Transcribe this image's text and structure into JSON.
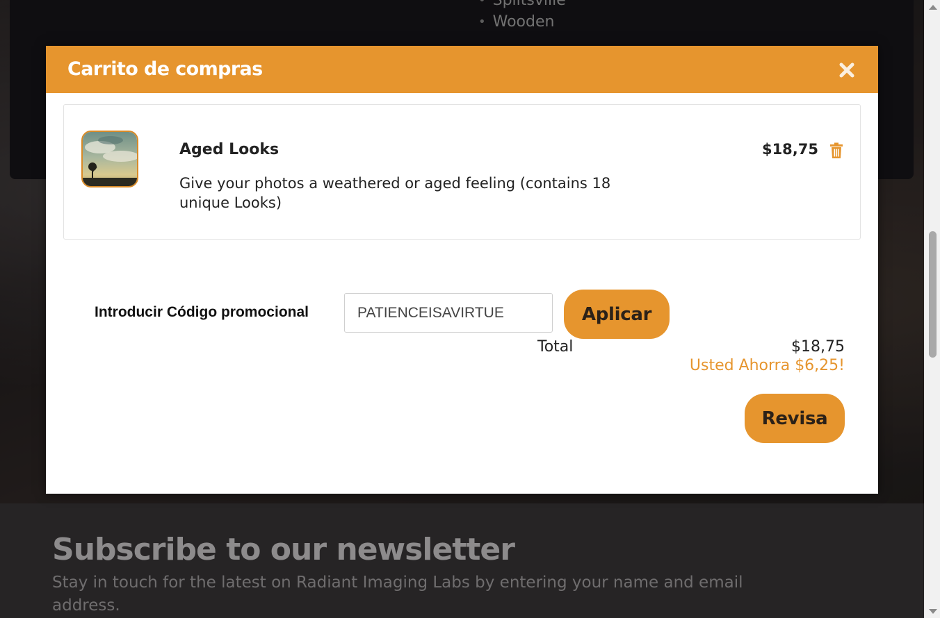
{
  "background": {
    "list_items": [
      "Splitsville",
      "Wooden"
    ],
    "newsletter": {
      "title": "Subscribe to our newsletter",
      "text": "Stay in touch for the latest on Radiant Imaging Labs by entering your name and email address."
    }
  },
  "cart": {
    "title": "Carrito de compras",
    "close_icon": "close-icon",
    "item": {
      "name": "Aged Looks",
      "description": "Give your photos a weathered or aged feeling (contains 18 unique Looks)",
      "price": "$18,75",
      "thumbnail": "aged-looks-thumbnail",
      "delete_icon": "trash-icon"
    },
    "promo": {
      "label": "Introducir Código promocional",
      "value": "PATIENCEISAVIRTUE",
      "apply_label": "Aplicar"
    },
    "total_label": "Total",
    "total_value": "$18,75",
    "savings_text": "Usted Ahorra $6,25!",
    "checkout_label": "Revisa"
  },
  "colors": {
    "accent": "#e6952e",
    "header_text": "#ffffff",
    "body_text": "#222222"
  }
}
